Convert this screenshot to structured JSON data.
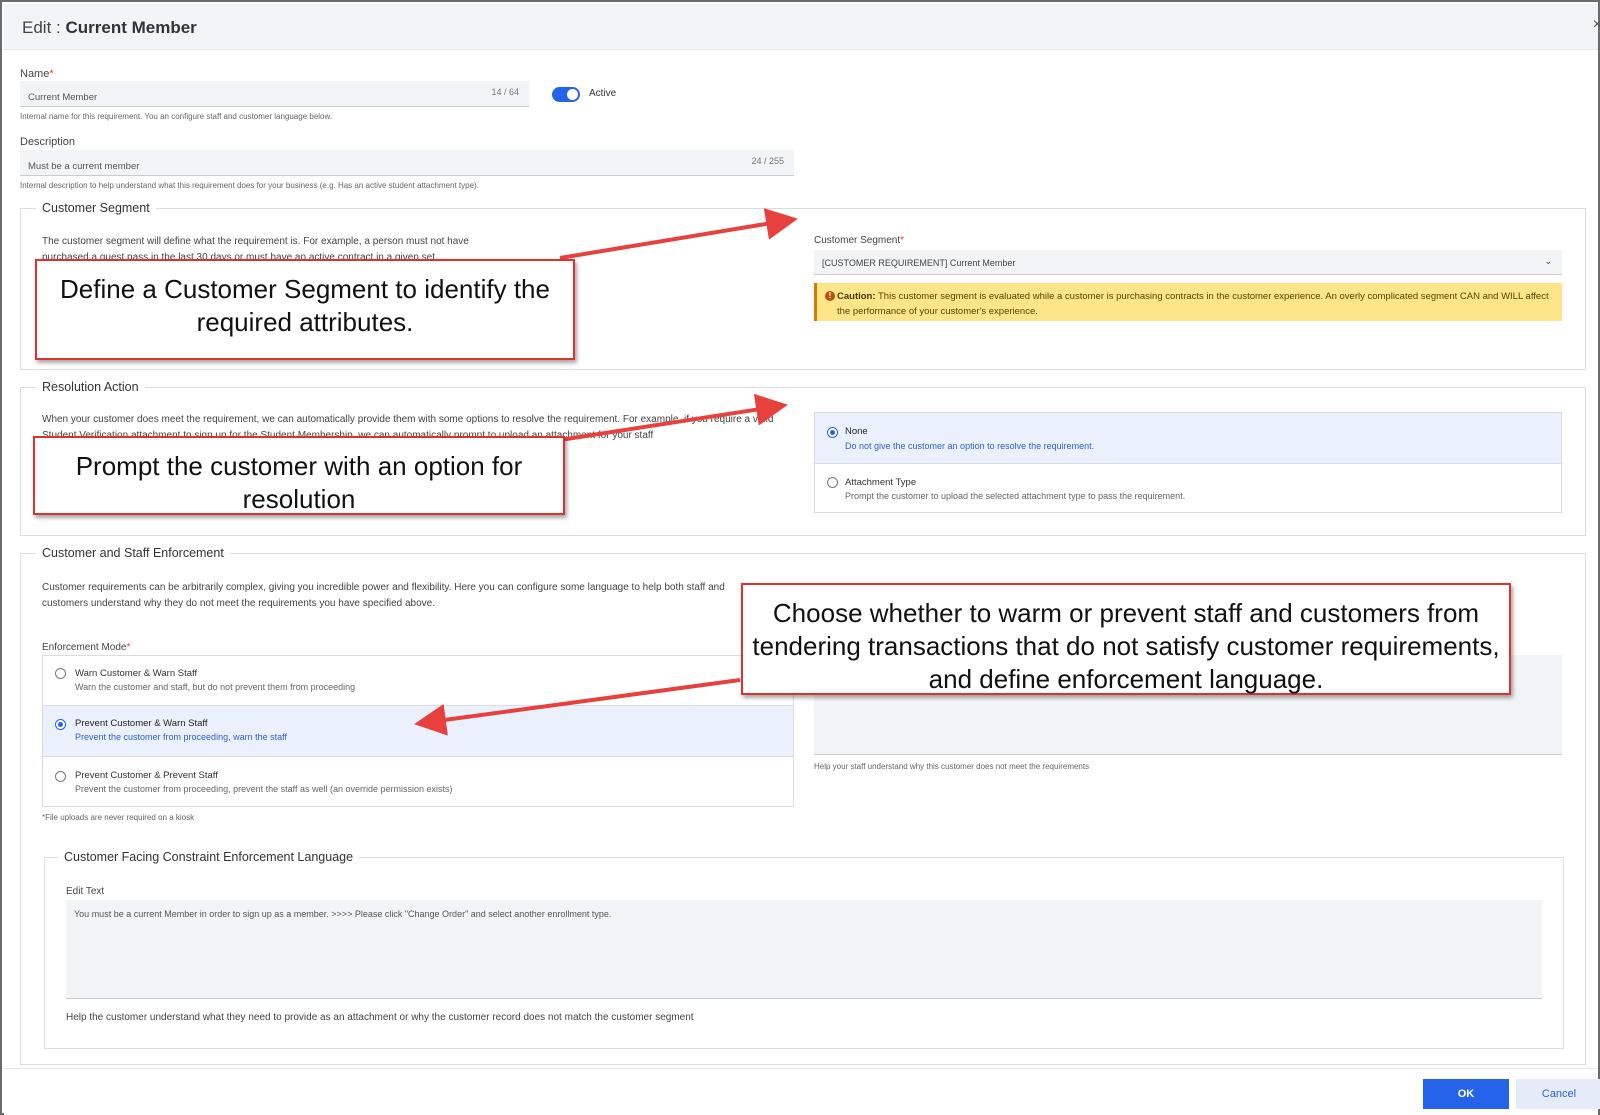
{
  "dialog": {
    "title_prefix": "Edit : ",
    "title_name": "Current Member",
    "close_glyph": "×"
  },
  "name_field": {
    "label": "Name",
    "required_mark": "*",
    "value": "Current Member",
    "counter": "14 / 64",
    "hint": "Internal name for this requirement. You an configure staff and customer language below."
  },
  "active_toggle": {
    "label": "Active",
    "on": true
  },
  "description_field": {
    "label": "Description",
    "value": "Must be a current member",
    "counter": "24 / 255",
    "hint": "Internal description to help understand what this requirement does for your business (e.g. Has an active student attachment type)."
  },
  "customer_segment_section": {
    "legend": "Customer Segment",
    "body": "The customer segment will define what the requirement is. For example, a person must not have purchased a guest pass in the last 30 days or must have an active contract in a given set.",
    "select_label": "Customer Segment",
    "required_mark": "*",
    "select_value": "[CUSTOMER REQUIREMENT] Current Member",
    "caution_label": "Caution:",
    "caution_text": "This customer segment is evaluated while a customer is purchasing contracts in the customer experience. An overly complicated segment CAN and WILL affect the performance of your customer's experience."
  },
  "resolution_section": {
    "legend": "Resolution Action",
    "body": "When your customer does meet the requirement, we can automatically provide them with some options to resolve the requirement. For example, if you require a valid Student Verification attachment to sign up for the Student Membership, we can automatically prompt to upload an attachment for your staff",
    "options": [
      {
        "title": "None",
        "desc": "Do not give the customer an option to resolve the requirement.",
        "selected": true
      },
      {
        "title": "Attachment Type",
        "desc": "Prompt the customer to upload the selected attachment type to pass the requirement.",
        "selected": false
      }
    ]
  },
  "enforcement_section": {
    "legend": "Customer and Staff Enforcement",
    "body": "Customer requirements can be arbitrarily complex, giving you incredible power and flexibility. Here you can configure some language to help both staff and customers understand why they do not meet the requirements you have specified above.",
    "mode_label": "Enforcement Mode",
    "required_mark": "*",
    "options": [
      {
        "title": "Warn Customer & Warn Staff",
        "desc": "Warn the customer and staff, but do not prevent them from proceeding",
        "selected": false
      },
      {
        "title": "Prevent Customer & Warn Staff",
        "desc": "Prevent the customer from proceeding, warn the staff",
        "selected": true
      },
      {
        "title": "Prevent Customer & Prevent Staff",
        "desc": "Prevent the customer from proceeding, prevent the staff as well (an override permission exists)",
        "selected": false
      }
    ],
    "footnote": "*File uploads are never required on a kiosk",
    "staff_hint": "Help your staff understand why this customer does not meet the requirements"
  },
  "customer_language_section": {
    "legend": "Customer Facing Constraint Enforcement Language",
    "edit_label": "Edit Text",
    "text": "You must be a current Member in order to sign up as a member. >>>> Please click \"Change Order\" and select another enrollment type.",
    "hint": "Help the customer understand what they need to provide as an attachment or why the customer record does not match the customer segment"
  },
  "footer": {
    "ok_label": "OK",
    "cancel_label": "Cancel"
  },
  "callouts": {
    "segment": "Define a Customer Segment to identify the required attributes.",
    "resolution": "Prompt the customer with an option for resolution",
    "enforcement": "Choose whether to warm or prevent staff and customers from tendering transactions that do not satisfy customer requirements, and define enforcement language."
  },
  "colors": {
    "accent": "#2563eb",
    "callout_border": "#e03131",
    "caution_bg": "#fde68a"
  }
}
